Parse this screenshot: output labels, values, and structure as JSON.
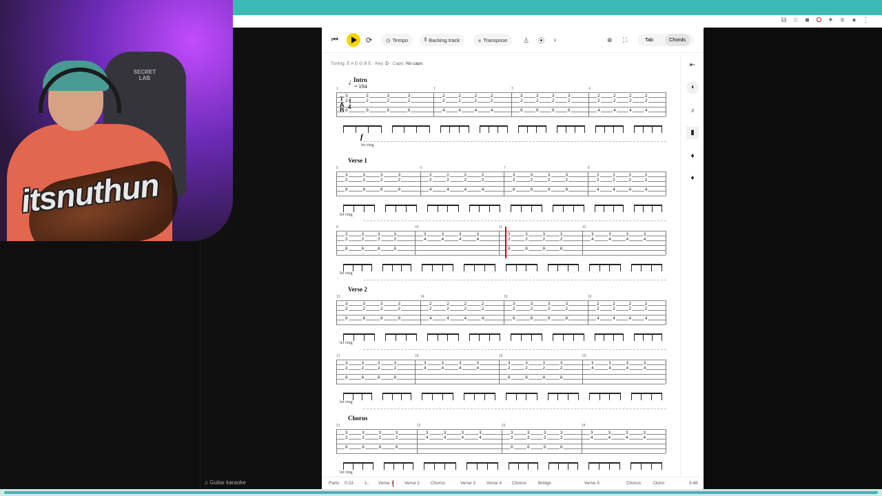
{
  "browser": {
    "icons": [
      "extension-icon",
      "star-icon",
      "profile-icon",
      "opera-icon",
      "extensions-icon",
      "menu-icon"
    ]
  },
  "webcam": {
    "logo": "itsnuthun",
    "chair_brand": "SECRET LAB"
  },
  "left_panel": {
    "karaoke_label": "Guitar karaoke"
  },
  "toolbar": {
    "tempo": "Tempo",
    "backing_track": "Backing track",
    "transpose": "Transpose",
    "tab": "Tab",
    "chords": "Chords"
  },
  "tuning": {
    "label": "Tuning:",
    "value": "E A D G B E",
    "key_label": "Key:",
    "key": "D",
    "capo_label": "Capo:",
    "capo": "No capo"
  },
  "sheet": {
    "intro": "Intro",
    "tempo_value": "= 104",
    "dynamic": "f",
    "let_ring": "let ring",
    "verse1": "Verse 1",
    "verse2": "Verse 2",
    "chorus": "Chorus"
  },
  "footer": {
    "parts": "Parts",
    "time": "0:23",
    "sections": [
      "1..",
      "Verse 1",
      "Verse 2",
      "Chorus",
      "Verse 3",
      "Verse 4",
      "Chorus",
      "Bridge",
      "Verse 5",
      "Chorus",
      "Outro"
    ],
    "duration": "3:48"
  }
}
